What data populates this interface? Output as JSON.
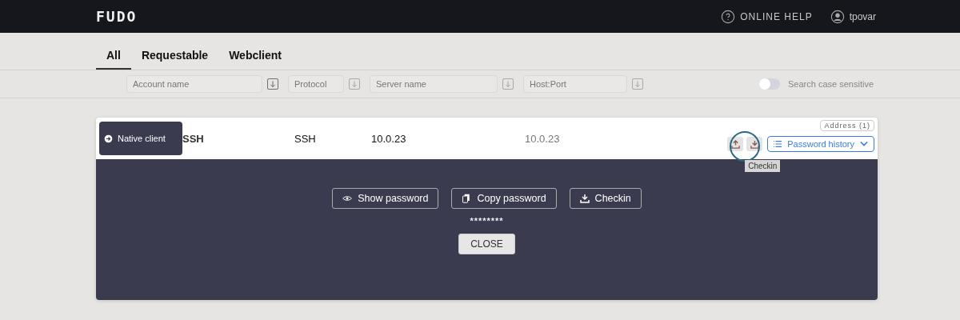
{
  "header": {
    "logo": "FUDO",
    "help": "ONLINE HELP",
    "user": "tpovar"
  },
  "tabs": [
    {
      "label": "All",
      "selected": true
    },
    {
      "label": "Requestable",
      "selected": false
    },
    {
      "label": "Webclient",
      "selected": false
    }
  ],
  "filters": [
    {
      "placeholder": "Account name",
      "sort_active": true
    },
    {
      "placeholder": "Protocol",
      "sort_active": false
    },
    {
      "placeholder": "Server name",
      "sort_active": false
    },
    {
      "placeholder": "Host:Port",
      "sort_active": false
    }
  ],
  "case_toggle": {
    "label": "Search case sensitive",
    "on": false
  },
  "account": {
    "client_button": "Native client",
    "name": "SSH",
    "protocol": "SSH",
    "server": "10.0.23",
    "host": "10.0.23",
    "address_badge": "Address (1)",
    "history_button": "Password history",
    "tooltip": "Checkin"
  },
  "panel": {
    "buttons": [
      {
        "kind": "show",
        "label": "Show password"
      },
      {
        "kind": "copy",
        "label": "Copy password"
      },
      {
        "kind": "checkin",
        "label": "Checkin"
      }
    ],
    "password": "********",
    "close": "CLOSE"
  }
}
